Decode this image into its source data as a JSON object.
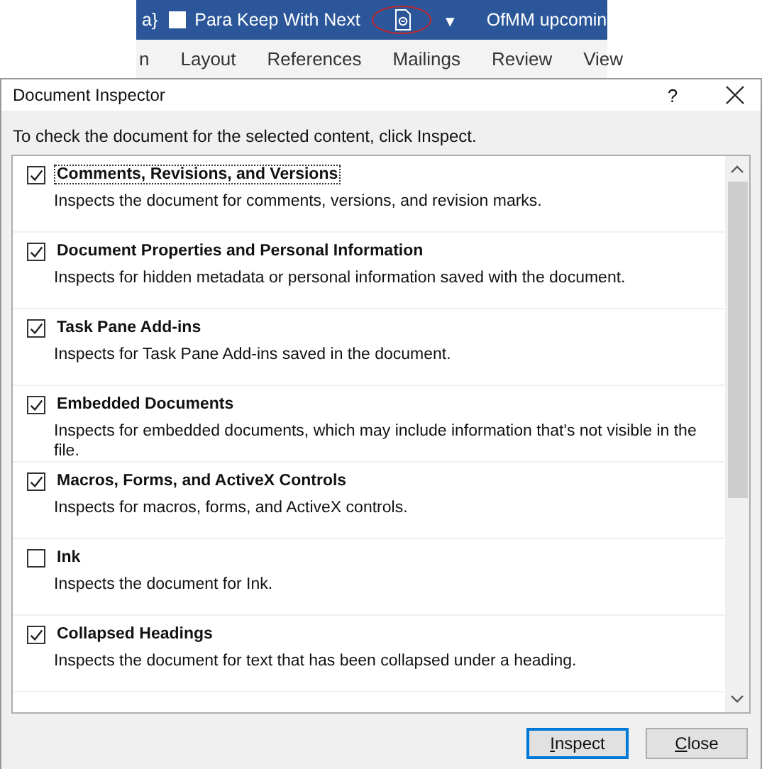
{
  "ribbon": {
    "quick_access": [
      {
        "kind": "text",
        "label": "a}"
      },
      {
        "kind": "checkbox",
        "label": "Para Keep With Next",
        "checked": false
      },
      {
        "kind": "doc-icon",
        "circled": true
      },
      {
        "kind": "dropdown",
        "label": "▾"
      },
      {
        "kind": "title",
        "label": "OfMM upcomin"
      }
    ],
    "tabs": [
      {
        "label": "n",
        "selected": false
      },
      {
        "label": "Layout",
        "selected": false
      },
      {
        "label": "References",
        "selected": false
      },
      {
        "label": "Mailings",
        "selected": false
      },
      {
        "label": "Review",
        "selected": false
      },
      {
        "label": "View",
        "selected": false
      }
    ]
  },
  "dialog": {
    "title": "Document Inspector",
    "help": "?",
    "intro": "To check the document for the selected content, click Inspect.",
    "items": [
      {
        "title": "Comments, Revisions, and Versions",
        "description": "Inspects the document for comments, versions, and revision marks.",
        "checked": true,
        "focused": true
      },
      {
        "title": "Document Properties and Personal Information",
        "description": "Inspects for hidden metadata or personal information saved with the document.",
        "checked": true,
        "focused": false
      },
      {
        "title": "Task Pane Add-ins",
        "description": "Inspects for Task Pane Add-ins saved in the document.",
        "checked": true,
        "focused": false
      },
      {
        "title": "Embedded Documents",
        "description": "Inspects for embedded documents, which may include information that's not visible in the file.",
        "checked": true,
        "focused": false
      },
      {
        "title": "Macros, Forms, and ActiveX Controls",
        "description": "Inspects for macros, forms, and ActiveX controls.",
        "checked": true,
        "focused": false
      },
      {
        "title": "Ink",
        "description": "Inspects the document for Ink.",
        "checked": false,
        "focused": false
      },
      {
        "title": "Collapsed Headings",
        "description": "Inspects the document for text that has been collapsed under a heading.",
        "checked": true,
        "focused": false
      }
    ],
    "buttons": [
      {
        "label": "Inspect",
        "default": true
      },
      {
        "label": "Close",
        "default": false
      }
    ]
  }
}
